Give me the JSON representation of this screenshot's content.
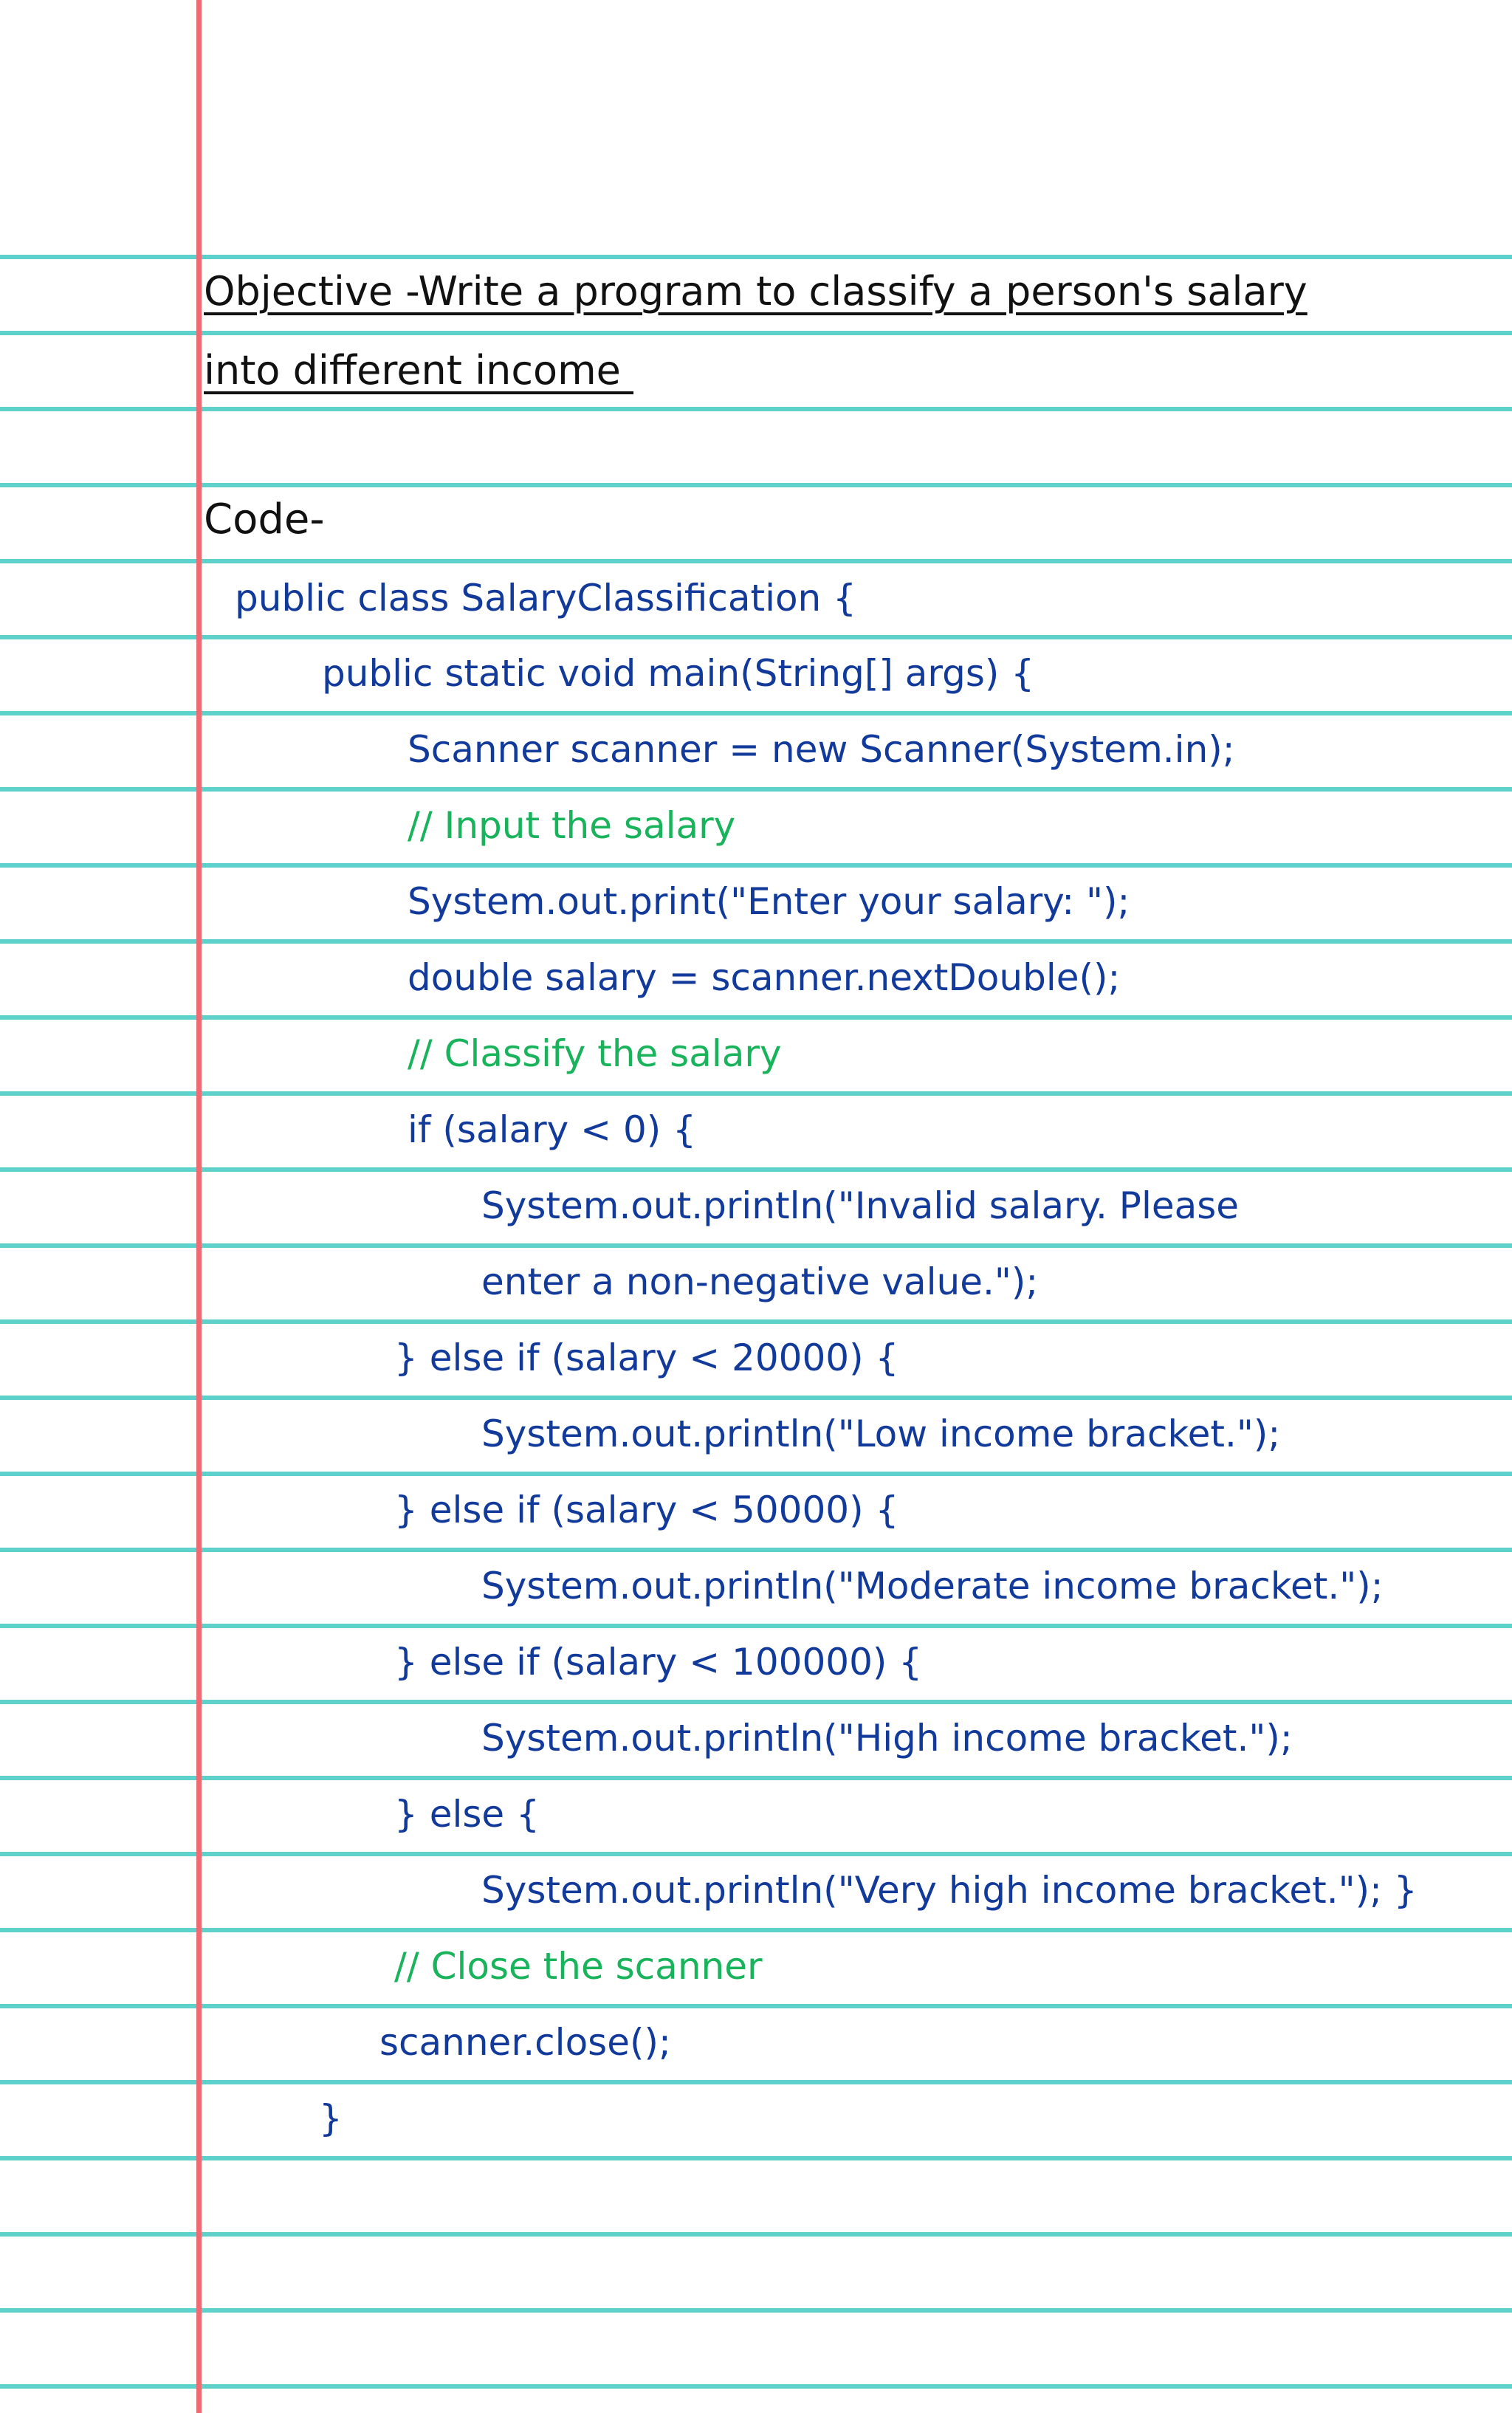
{
  "colors": {
    "rule": "#5fd1cc",
    "margin": "#ef6a72",
    "heading_text": "#111111",
    "code_text": "#123a9a",
    "comment_text": "#18b35b"
  },
  "objective": {
    "line1": "Objective -Write a program to classify a person's salary",
    "line2": "into different income "
  },
  "code_label": "Code-",
  "code_lines": [
    "public class SalaryClassification {",
    "public static void main(String[] args) {",
    "Scanner scanner = new Scanner(System.in);",
    "// Input the salary",
    "System.out.print(\"Enter your salary: \");",
    "double salary = scanner.nextDouble();",
    "// Classify the salary",
    "if (salary < 0) {",
    "System.out.println(\"Invalid salary. Please",
    "enter a non-negative value.\");",
    "} else if (salary < 20000) {",
    "System.out.println(\"Low income bracket.\");",
    "} else if (salary < 50000) {",
    "System.out.println(\"Moderate income bracket.\");",
    "} else if (salary < 100000) {",
    "System.out.println(\"High income bracket.\");",
    "} else {",
    "System.out.println(\"Very high income bracket.\"); }",
    "// Close the scanner",
    "scanner.close();",
    "}"
  ]
}
